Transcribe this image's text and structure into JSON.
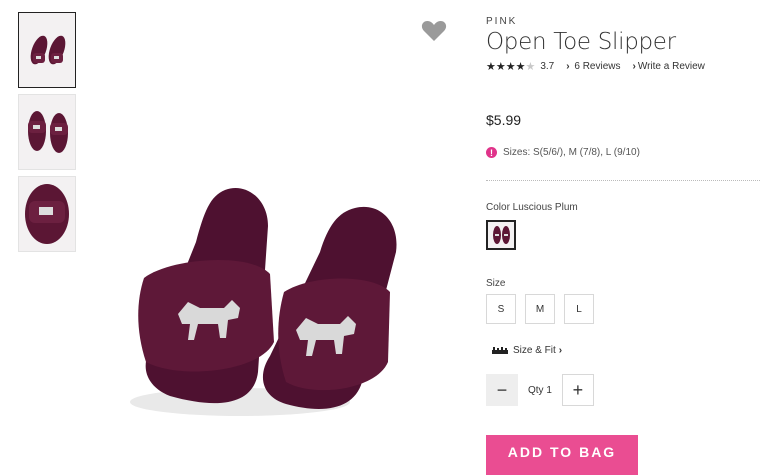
{
  "thumbnails": [
    {
      "name": "thumbnail-pair-top-view",
      "active": true
    },
    {
      "name": "thumbnail-pair-front-view",
      "active": false
    },
    {
      "name": "thumbnail-single-closeup",
      "active": false
    }
  ],
  "wishlist": {
    "icon": "heart-icon",
    "color": "#9a9a9a"
  },
  "product": {
    "brand": "PINK",
    "title": "Open Toe Slipper",
    "stars_filled": "★★★★",
    "stars_empty": "★",
    "rating": "3.7",
    "reviews_link": "6 Reviews",
    "write_review_link": "Write a Review",
    "price": "$5.99",
    "sizes_note": "Sizes: S(5/6/), M (7/8), L (9/10)",
    "color_label": "Color Luscious Plum",
    "size_label": "Size",
    "sizes": [
      "S",
      "M",
      "L"
    ],
    "size_fit_link": "Size & Fit",
    "qty_label": "Qty 1",
    "add_to_bag": "ADD TO BAG"
  },
  "colors": {
    "accent": "#ea4d92",
    "plum": "#5b1634",
    "alert": "#e0338a"
  }
}
